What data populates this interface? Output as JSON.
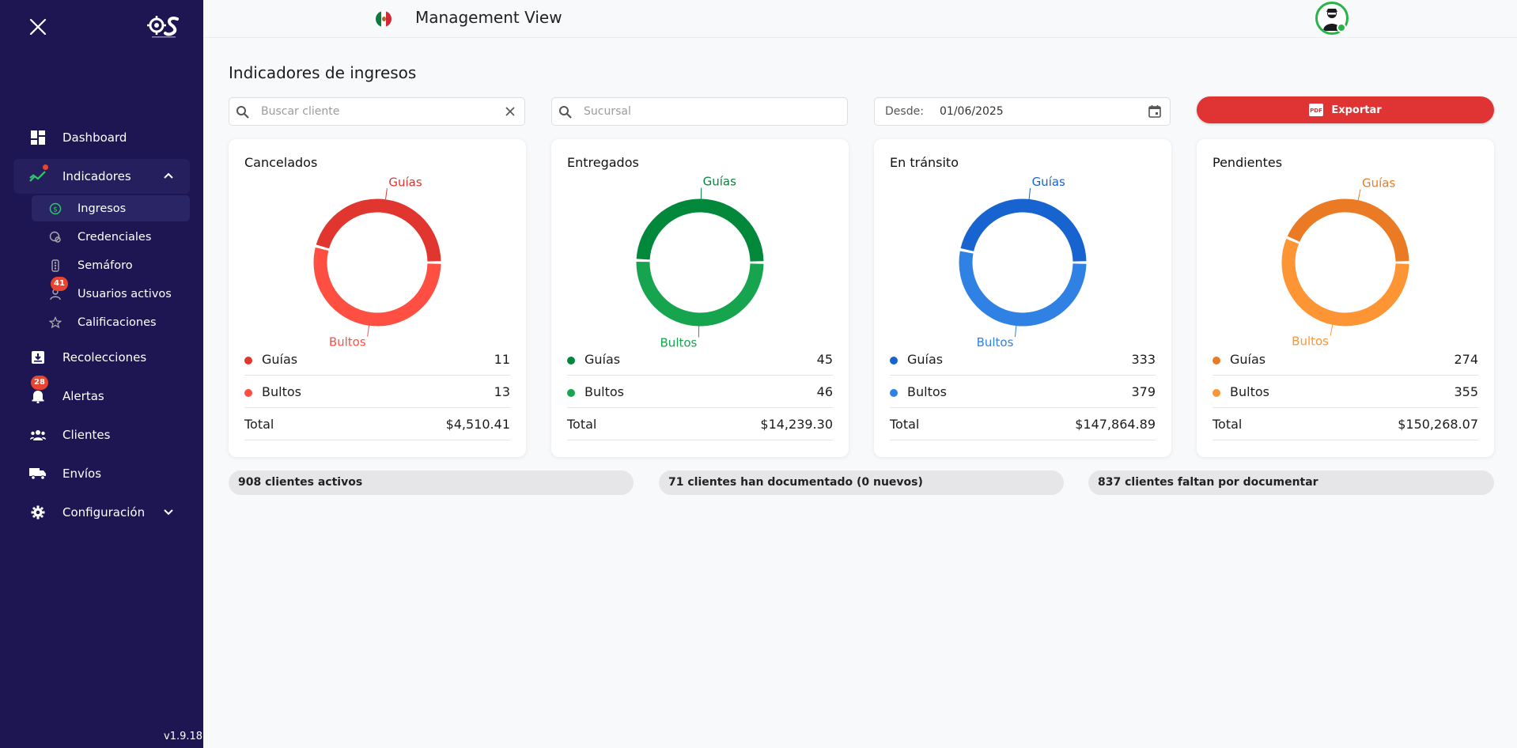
{
  "sidebar": {
    "version": "v1.9.18",
    "items": [
      {
        "label": "Dashboard"
      },
      {
        "label": "Indicadores"
      },
      {
        "label": "Recolecciones"
      },
      {
        "label": "Alertas",
        "badge": "28"
      },
      {
        "label": "Clientes"
      },
      {
        "label": "Envíos"
      },
      {
        "label": "Configuración"
      }
    ],
    "subitems": [
      {
        "label": "Ingresos"
      },
      {
        "label": "Credenciales"
      },
      {
        "label": "Semáforo"
      },
      {
        "label": "Usuarios activos",
        "badge": "41"
      },
      {
        "label": "Calificaciones"
      }
    ]
  },
  "header": {
    "title": "Management View"
  },
  "main": {
    "title": "Indicadores de ingresos",
    "search_client_placeholder": "Buscar cliente",
    "branch_placeholder": "Sucursal",
    "date_label": "Desde:",
    "date_value": "01/06/2025",
    "export_label": "Exportar"
  },
  "chart_data": [
    {
      "type": "pie",
      "title": "Cancelados",
      "categories": [
        "Guías",
        "Bultos"
      ],
      "values": [
        11,
        13
      ],
      "colors": [
        "#e1352f",
        "#ff4f43"
      ],
      "total_label": "Total",
      "total_value": "$4,510.41"
    },
    {
      "type": "pie",
      "title": "Entregados",
      "categories": [
        "Guías",
        "Bultos"
      ],
      "values": [
        45,
        46
      ],
      "colors": [
        "#02883a",
        "#17a44e"
      ],
      "total_label": "Total",
      "total_value": "$14,239.30"
    },
    {
      "type": "pie",
      "title": "En tránsito",
      "categories": [
        "Guías",
        "Bultos"
      ],
      "values": [
        333,
        379
      ],
      "colors": [
        "#1763d0",
        "#2f82e3"
      ],
      "total_label": "Total",
      "total_value": "$147,864.89"
    },
    {
      "type": "pie",
      "title": "Pendientes",
      "categories": [
        "Guías",
        "Bultos"
      ],
      "values": [
        274,
        355
      ],
      "colors": [
        "#ea7a24",
        "#fd9534"
      ],
      "total_label": "Total",
      "total_value": "$150,268.07"
    }
  ],
  "stats": [
    {
      "text": "908 clientes activos"
    },
    {
      "text": "71 clientes han documentado (0 nuevos)"
    },
    {
      "text": "837 clientes faltan por documentar"
    }
  ],
  "colors": {
    "sidebar_bg": "#1d1653",
    "accent_red": "#e03333",
    "online_green": "#28b449"
  }
}
